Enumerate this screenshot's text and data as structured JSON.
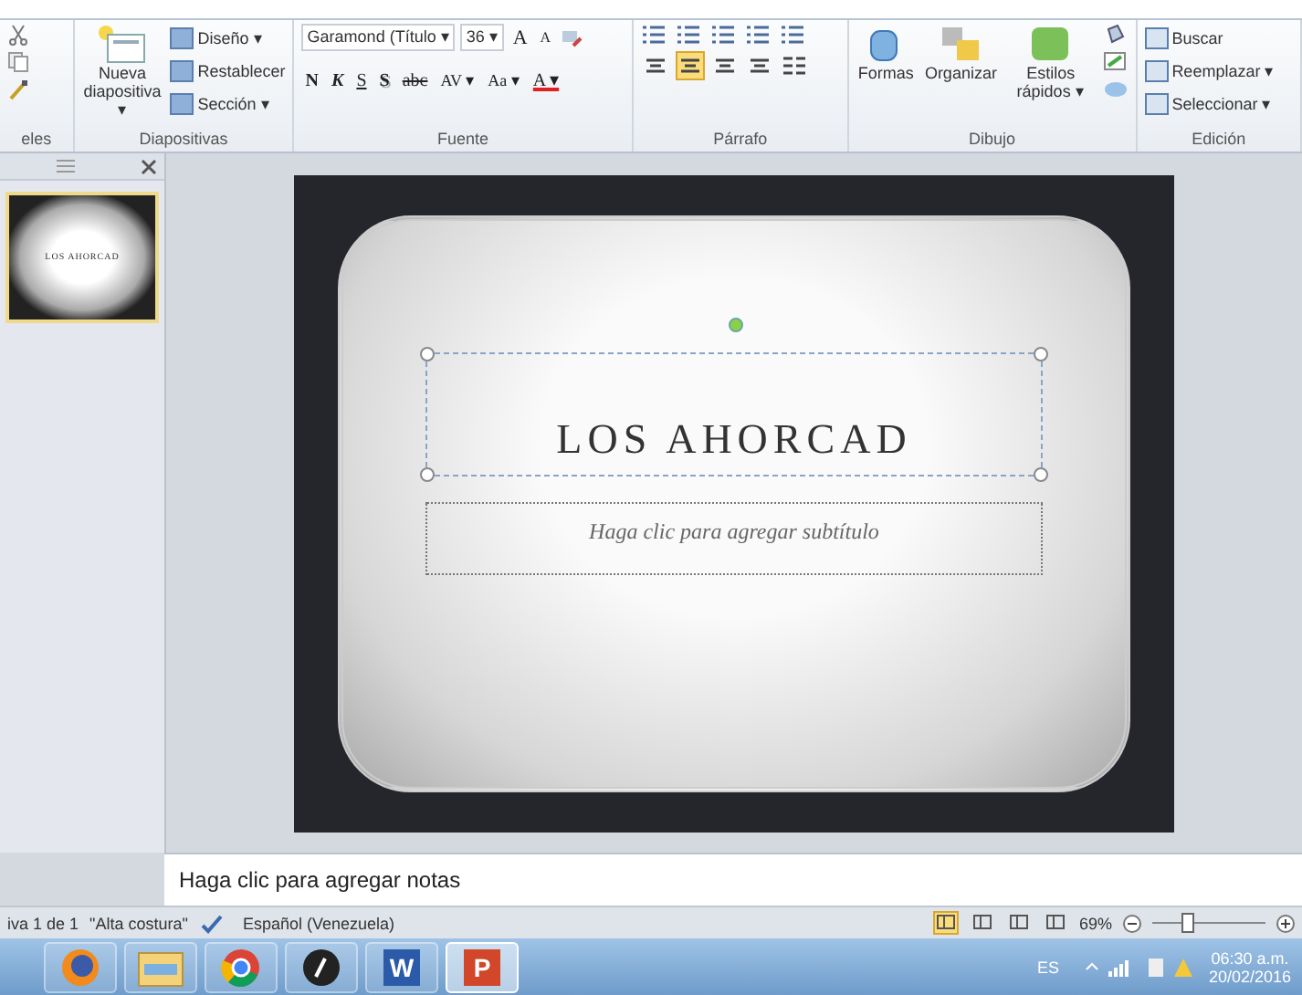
{
  "ribbon": {
    "groups": [
      {
        "kind": "clipboard",
        "label": "eles"
      },
      {
        "kind": "slides",
        "label": "Diapositivas",
        "big": [
          "Nueva",
          "diapositiva ▾"
        ],
        "small": [
          "Diseño ▾",
          "Restablecer",
          "Sección ▾"
        ]
      },
      {
        "kind": "font",
        "label": "Fuente",
        "font": "Garamond (Título ▾",
        "size": "36 ▾",
        "grow": [
          "A",
          "A"
        ],
        "buttons": [
          {
            "kind": "bold",
            "text": "N"
          },
          {
            "kind": "italic",
            "text": "K"
          },
          {
            "kind": "underline",
            "text": "S"
          },
          {
            "kind": "shadow",
            "text": "S"
          },
          {
            "kind": "strike",
            "text": "abc"
          },
          {
            "kind": "spacing",
            "text": "AV ▾"
          },
          {
            "kind": "case",
            "text": "Aa ▾"
          },
          {
            "kind": "color",
            "text": "A ▾"
          }
        ]
      },
      {
        "kind": "paragraph",
        "label": "Párrafo",
        "align": [
          {
            "selected": false
          },
          {
            "selected": true
          },
          {
            "selected": false
          },
          {
            "selected": false
          }
        ]
      },
      {
        "kind": "drawing",
        "label": "Dibujo",
        "big": [
          "Formas",
          "Organizar",
          "Estilos rápidos ▾"
        ]
      },
      {
        "kind": "editing",
        "label": "Edición",
        "small": [
          "Buscar",
          "Reemplazar ▾",
          "Seleccionar ▾"
        ]
      }
    ]
  },
  "thumbnails": [
    {
      "title": "LOS AHORCAD",
      "selected": true
    }
  ],
  "slide": {
    "title": "LOS AHORCAD",
    "subtitle_prompt": "Haga clic para agregar subtítulo"
  },
  "notes": {
    "placeholder": "Haga clic para agregar notas"
  },
  "status_bar": {
    "slide": "iva 1 de 1",
    "theme": "\"Alta costura\"",
    "language": "Español (Venezuela)",
    "views": [
      {
        "selected": true
      },
      {
        "selected": false
      },
      {
        "selected": false
      },
      {
        "selected": false
      }
    ],
    "zoom": "69%",
    "level": 0.3
  },
  "taskbar": {
    "apps": [
      {
        "kind": "globe",
        "selected": false
      },
      {
        "kind": "folder",
        "selected": false
      },
      {
        "kind": "ring",
        "selected": false
      },
      {
        "kind": "disc",
        "selected": false
      },
      {
        "kind": "word",
        "letter": "W",
        "selected": false
      },
      {
        "kind": "slides",
        "letter": "P",
        "selected": true
      }
    ],
    "language": "ES",
    "time": "06:30 a.m.",
    "date": "20/02/2016"
  }
}
